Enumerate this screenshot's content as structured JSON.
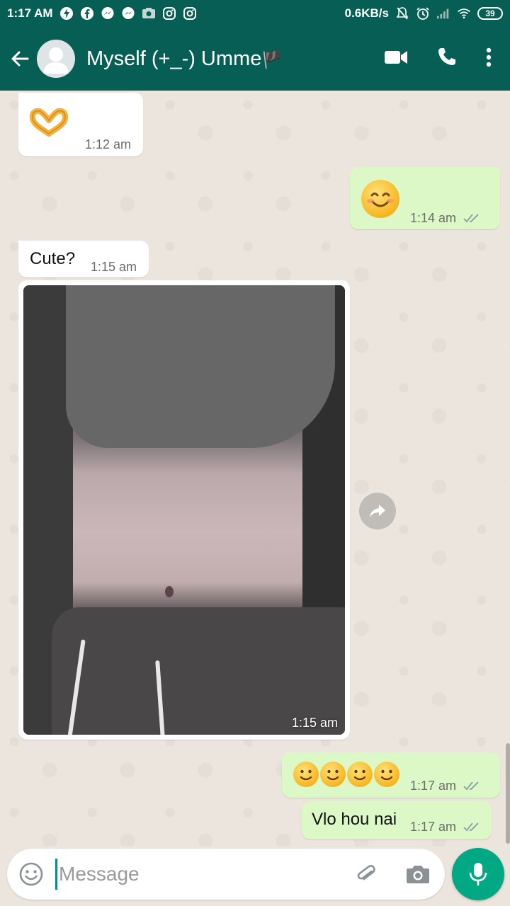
{
  "status_bar": {
    "time": "1:17 AM",
    "net_speed": "0.6KB/s",
    "battery": "39",
    "icons": [
      "bolt-icon",
      "facebook-icon",
      "messenger-icon",
      "messenger-icon",
      "photo-icon",
      "instagram-icon",
      "instagram-icon",
      "mute-icon",
      "alarm-icon",
      "signal-icon",
      "wifi-icon"
    ]
  },
  "header": {
    "contact_name": "Myself (+_-) Umme",
    "flag": "🏴",
    "actions": [
      "video-call-icon",
      "voice-call-icon",
      "more-options-icon"
    ]
  },
  "messages": [
    {
      "direction": "in",
      "type": "emoji",
      "content": "🫶",
      "time": "1:12 am"
    },
    {
      "direction": "out",
      "type": "emoji",
      "content": "😊",
      "time": "1:14 am",
      "status": "read"
    },
    {
      "direction": "in",
      "type": "text",
      "content": "Cute?",
      "time": "1:15 am"
    },
    {
      "direction": "in",
      "type": "image",
      "time": "1:15 am"
    },
    {
      "direction": "out",
      "type": "emoji",
      "content": "🙂🙂🙂🙂",
      "time": "1:17 am",
      "status": "read"
    },
    {
      "direction": "out",
      "type": "text",
      "content": "Vlo hou nai",
      "time": "1:17 am",
      "status": "read"
    }
  ],
  "input": {
    "placeholder": "Message"
  },
  "colors": {
    "header": "#075E54",
    "chat_bg": "#ECE5DD",
    "outgoing": "#DCF8C6",
    "incoming": "#FFFFFF",
    "accent": "#00A884",
    "read_ticks": "#8a9aa3"
  }
}
